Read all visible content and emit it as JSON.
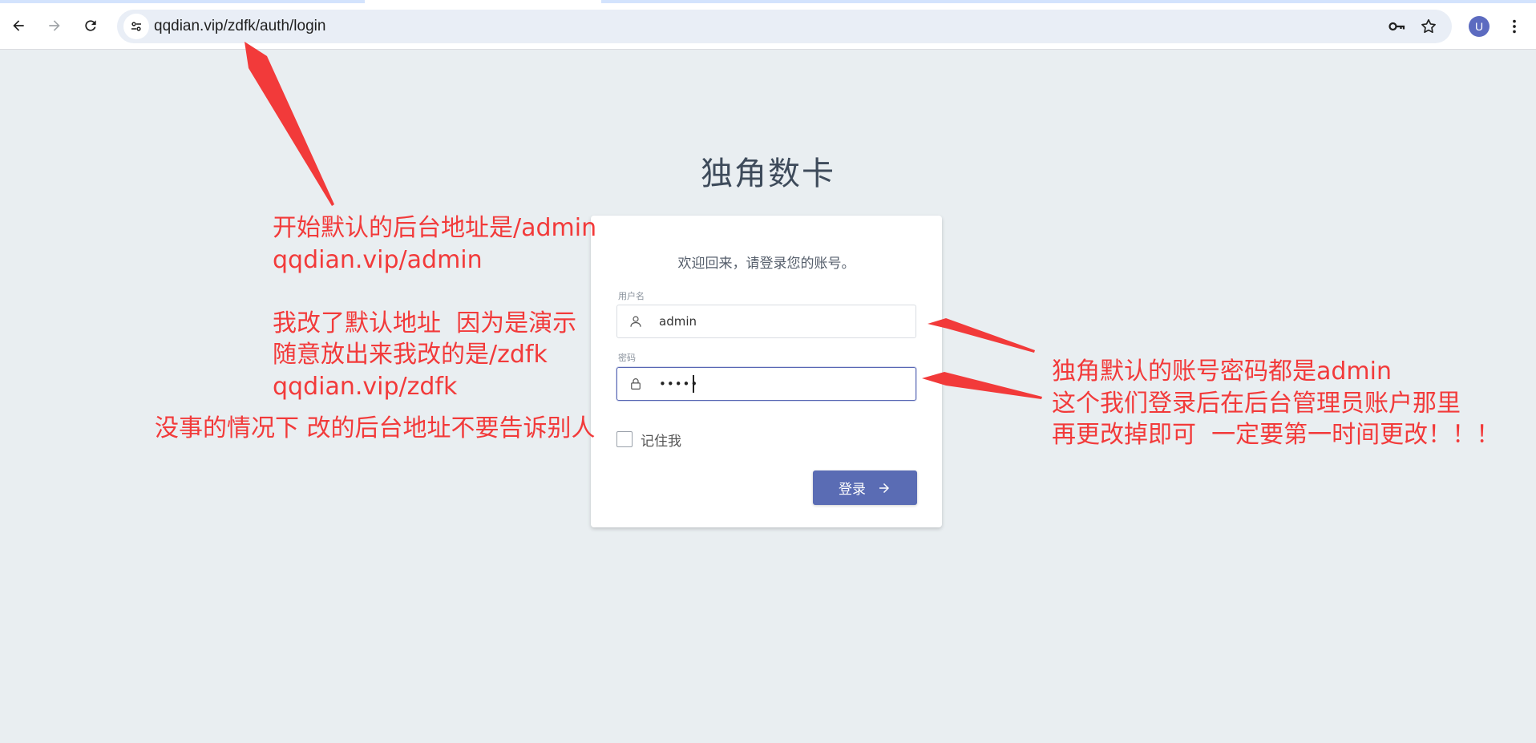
{
  "browser": {
    "url": "qqdian.vip/zdfk/auth/login",
    "profile_initial": "U",
    "icons": {
      "back": "arrow-left-icon",
      "forward": "arrow-right-icon",
      "reload": "reload-icon",
      "site_info": "tune-icon",
      "password": "key-icon",
      "bookmark": "star-icon",
      "menu": "more-vert-icon"
    }
  },
  "page": {
    "brand": "独角数卡",
    "welcome": "欢迎回来，请登录您的账号。",
    "username_label": "用户名",
    "username_value": "admin",
    "password_label": "密码",
    "password_value": "•••••",
    "remember_label": "记住我",
    "login_label": "登录",
    "icons": {
      "user": "user-icon",
      "lock": "lock-icon",
      "login_arrow": "arrow-right-icon"
    }
  },
  "annotations": {
    "left_block": "开始默认的后台地址是/admin\nqqdian.vip/admin\n\n我改了默认地址  因为是演示\n随意放出来我改的是/zdfk\nqqdian.vip/zdfk",
    "left_note": "没事的情况下 改的后台地址不要告诉别人",
    "right_block": "独角默认的账号密码都是admin\n这个我们登录后在后台管理员账户那里\n再更改掉即可  一定要第一时间更改！！！",
    "color": "#f23a3a"
  }
}
